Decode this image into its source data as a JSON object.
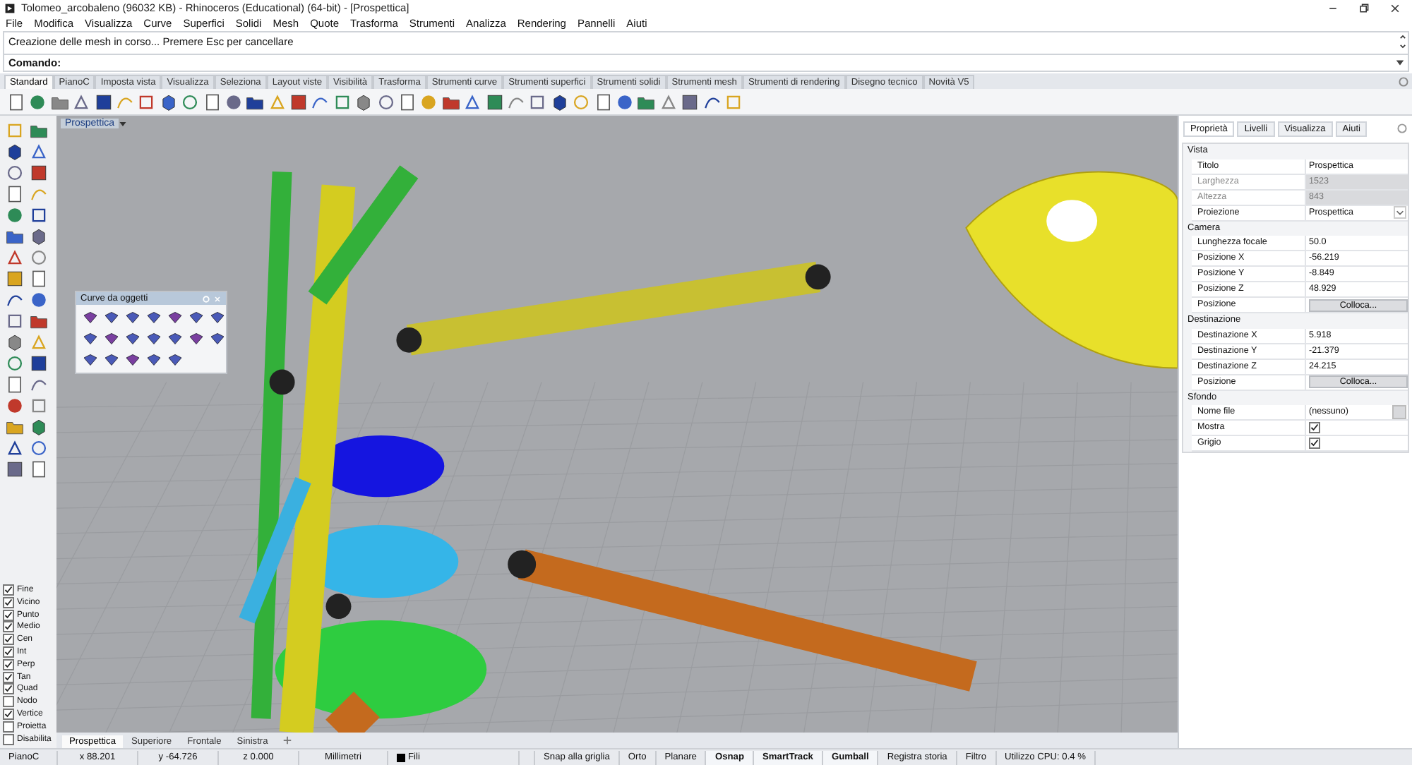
{
  "window": {
    "title": "Tolomeo_arcobaleno (96032 KB) - Rhinoceros (Educational) (64-bit) - [Prospettica]"
  },
  "menu": [
    "File",
    "Modifica",
    "Visualizza",
    "Curve",
    "Superfici",
    "Solidi",
    "Mesh",
    "Quote",
    "Trasforma",
    "Strumenti",
    "Analizza",
    "Rendering",
    "Pannelli",
    "Aiuti"
  ],
  "command_history": [
    "Creazione delle mesh in corso... Premere Esc per cancellare"
  ],
  "command_prompt": {
    "label": "Comando:"
  },
  "toolbar_tabs": [
    {
      "label": "Standard",
      "selected": true
    },
    {
      "label": "PianoC",
      "selected": false
    },
    {
      "label": "Imposta vista",
      "selected": false
    },
    {
      "label": "Visualizza",
      "selected": false
    },
    {
      "label": "Seleziona",
      "selected": false
    },
    {
      "label": "Layout viste",
      "selected": false
    },
    {
      "label": "Visibilità",
      "selected": false
    },
    {
      "label": "Trasforma",
      "selected": false
    },
    {
      "label": "Strumenti curve",
      "selected": false
    },
    {
      "label": "Strumenti superfici",
      "selected": false
    },
    {
      "label": "Strumenti solidi",
      "selected": false
    },
    {
      "label": "Strumenti mesh",
      "selected": false
    },
    {
      "label": "Strumenti di rendering",
      "selected": false
    },
    {
      "label": "Disegno tecnico",
      "selected": false
    },
    {
      "label": "Novità V5",
      "selected": false
    }
  ],
  "viewport": {
    "title": "Prospettica",
    "floating_toolbar": {
      "title": "Curve da oggetti"
    },
    "tabs": [
      {
        "label": "Prospettica",
        "selected": true
      },
      {
        "label": "Superiore",
        "selected": false
      },
      {
        "label": "Frontale",
        "selected": false
      },
      {
        "label": "Sinistra",
        "selected": false
      }
    ]
  },
  "osnaps": [
    {
      "label": "Fine",
      "checked": true
    },
    {
      "label": "Vicino",
      "checked": true
    },
    {
      "label": "Punto",
      "checked": true
    },
    {
      "label": "Medio",
      "checked": true
    },
    {
      "label": "Cen",
      "checked": true
    },
    {
      "label": "Int",
      "checked": true
    },
    {
      "label": "Perp",
      "checked": true
    },
    {
      "label": "Tan",
      "checked": true
    },
    {
      "label": "Quad",
      "checked": true
    },
    {
      "label": "Nodo",
      "checked": false
    },
    {
      "label": "Vertice",
      "checked": true
    },
    {
      "label": "Proietta",
      "checked": false
    },
    {
      "label": "Disabilita",
      "checked": false
    }
  ],
  "properties": {
    "tabs": [
      {
        "label": "Proprietà",
        "selected": true
      },
      {
        "label": "Livelli",
        "selected": false
      },
      {
        "label": "Visualizza",
        "selected": false
      },
      {
        "label": "Aiuti",
        "selected": false
      }
    ],
    "sections": [
      {
        "title": "Vista",
        "rows": [
          {
            "label": "Titolo",
            "kind": "text",
            "value": "Prospettica"
          },
          {
            "label": "Larghezza",
            "kind": "readonly",
            "value": "1523"
          },
          {
            "label": "Altezza",
            "kind": "readonly",
            "value": "843"
          },
          {
            "label": "Proiezione",
            "kind": "dropdown",
            "value": "Prospettica"
          }
        ]
      },
      {
        "title": "Camera",
        "rows": [
          {
            "label": "Lunghezza focale",
            "kind": "text",
            "value": "50.0"
          },
          {
            "label": "Posizione X",
            "kind": "text",
            "value": "-56.219"
          },
          {
            "label": "Posizione Y",
            "kind": "text",
            "value": "-8.849"
          },
          {
            "label": "Posizione Z",
            "kind": "text",
            "value": "48.929"
          },
          {
            "label": "Posizione",
            "kind": "button",
            "value": "Colloca..."
          }
        ]
      },
      {
        "title": "Destinazione",
        "rows": [
          {
            "label": "Destinazione X",
            "kind": "text",
            "value": "5.918"
          },
          {
            "label": "Destinazione Y",
            "kind": "text",
            "value": "-21.379"
          },
          {
            "label": "Destinazione Z",
            "kind": "text",
            "value": "24.215"
          },
          {
            "label": "Posizione",
            "kind": "button",
            "value": "Colloca..."
          }
        ]
      },
      {
        "title": "Sfondo",
        "rows": [
          {
            "label": "Nome file",
            "kind": "file",
            "value": "(nessuno)"
          },
          {
            "label": "Mostra",
            "kind": "checkbox",
            "checked": true
          },
          {
            "label": "Grigio",
            "kind": "checkbox",
            "checked": true
          }
        ]
      }
    ]
  },
  "status_bar": [
    {
      "text": "PianoC",
      "kind": "plain"
    },
    {
      "text": "x 88.201",
      "kind": "plain"
    },
    {
      "text": "y -64.726",
      "kind": "plain"
    },
    {
      "text": "z 0.000",
      "kind": "plain"
    },
    {
      "text": "Millimetri",
      "kind": "plain"
    },
    {
      "text": "Fili",
      "kind": "layer"
    },
    {
      "text": "Snap alla griglia",
      "kind": "toggle",
      "on": false
    },
    {
      "text": "Orto",
      "kind": "toggle",
      "on": false
    },
    {
      "text": "Planare",
      "kind": "toggle",
      "on": false
    },
    {
      "text": "Osnap",
      "kind": "toggle",
      "on": true
    },
    {
      "text": "SmartTrack",
      "kind": "toggle",
      "on": true
    },
    {
      "text": "Gumball",
      "kind": "toggle",
      "on": true
    },
    {
      "text": "Registra storia",
      "kind": "toggle",
      "on": false
    },
    {
      "text": "Filtro",
      "kind": "toggle",
      "on": false
    },
    {
      "text": "Utilizzo CPU: 0.4 %",
      "kind": "plain"
    }
  ]
}
